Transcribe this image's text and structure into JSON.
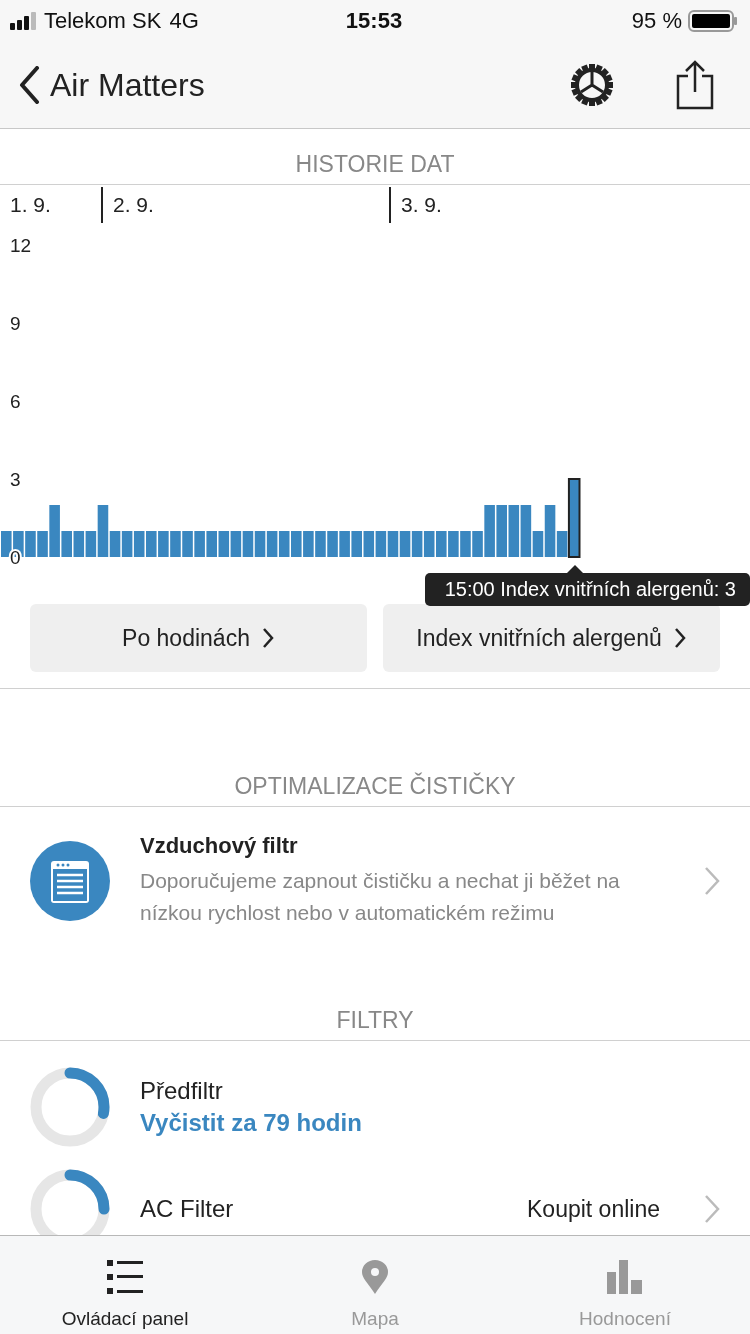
{
  "status_bar": {
    "carrier": "Telekom SK",
    "network": "4G",
    "time": "15:53",
    "battery": "95 %"
  },
  "nav": {
    "title": "Air Matters"
  },
  "history": {
    "header": "HISTORIE DAT",
    "days": [
      "1. 9.",
      "2. 9.",
      "3. 9."
    ],
    "chart_data": {
      "type": "bar",
      "ylim": [
        0,
        12
      ],
      "yticks": [
        0,
        3,
        6,
        9,
        12
      ],
      "categories": [
        null,
        null,
        null,
        null,
        null,
        null,
        null,
        null,
        null,
        null,
        null,
        null,
        null,
        null,
        null,
        null,
        null,
        null,
        null,
        null,
        null,
        null,
        null,
        null,
        null,
        null,
        null,
        null,
        null,
        null,
        null,
        null,
        null,
        null,
        null,
        null,
        null,
        null,
        null,
        null,
        null,
        null,
        null,
        null,
        null,
        null,
        null,
        null
      ],
      "series": [
        {
          "color": "#3a87c0",
          "values": [
            1,
            1,
            1,
            1,
            2,
            1,
            1,
            1,
            2,
            1,
            1,
            1,
            1,
            1,
            1,
            1,
            1,
            1,
            1,
            1,
            1,
            1,
            1,
            1,
            1,
            1,
            1,
            1,
            1,
            1,
            1,
            1,
            1,
            1,
            1,
            1,
            1,
            1,
            1,
            1,
            2,
            2,
            2,
            2,
            1,
            2,
            1,
            3
          ]
        }
      ]
    },
    "tooltip": "15:00 Index vnitřních alergenů: 3",
    "buttons": [
      "Po hodinách",
      "Index vnitřních alergenů"
    ]
  },
  "optimization": {
    "header": "OPTIMALIZACE ČISTIČKY",
    "item": {
      "title": "Vzduchový filtr",
      "description": "Doporučujeme zapnout čističku a nechat ji běžet na nízkou rychlost nebo v automatickém režimu"
    }
  },
  "filters": {
    "header": "FILTRY",
    "items": [
      {
        "name": "Předfiltr",
        "status": "Vyčistit za 79 hodin",
        "level": 0.28
      },
      {
        "name": "AC Filter",
        "action": "Koupit online",
        "level": 0.25
      }
    ]
  },
  "tab_bar": [
    {
      "label": "Ovládací panel",
      "selected": true
    },
    {
      "label": "Mapa",
      "selected": false
    },
    {
      "label": "Hodnocení",
      "selected": false
    }
  ]
}
